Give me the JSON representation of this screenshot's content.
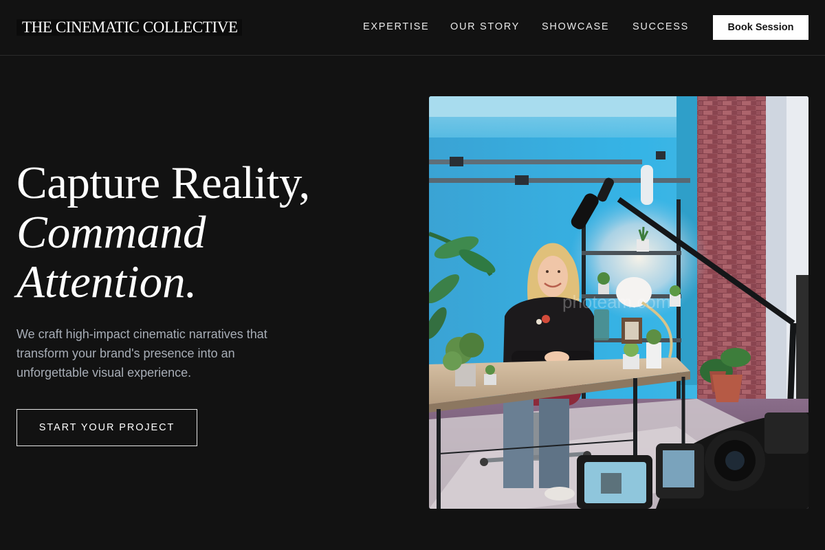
{
  "brand": {
    "name": "THE CINEMATIC COLLECTIVE"
  },
  "nav": {
    "items": [
      {
        "label": "EXPERTISE"
      },
      {
        "label": "OUR STORY"
      },
      {
        "label": "SHOWCASE"
      },
      {
        "label": "SUCCESS"
      }
    ],
    "cta_label": "Book Session"
  },
  "hero": {
    "headline_line1": "Capture Reality,",
    "headline_line2": "Command",
    "headline_line3": "Attention.",
    "subtext": "We craft high-impact cinematic narratives that transform your brand's presence into an unforgettable visual experience.",
    "cta_label": "START YOUR PROJECT",
    "image_watermark": "photeam.com"
  },
  "colors": {
    "background": "#121212",
    "text_primary": "#ffffff",
    "text_muted": "#a7adb6",
    "button_bg": "#ffffff",
    "button_text": "#141414"
  }
}
